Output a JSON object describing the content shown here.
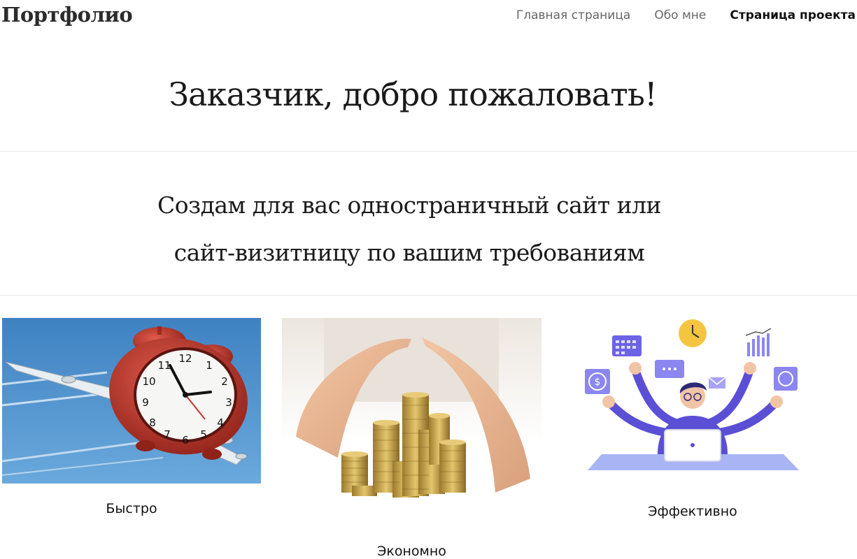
{
  "header": {
    "brand": "Портфолио",
    "nav": [
      {
        "label": "Главная страница",
        "active": false
      },
      {
        "label": "Обо мне",
        "active": false
      },
      {
        "label": "Страница проекта",
        "active": true
      }
    ]
  },
  "hero": {
    "title": "Заказчик, добро пожаловать!"
  },
  "intro": {
    "line1": "Создам для вас одностраничный сайт или",
    "line2": "сайт-визитницу по вашим требованиям"
  },
  "features": [
    {
      "label": "Быстро",
      "image": "alarm-clock-with-wings-image"
    },
    {
      "label": "Экономно",
      "image": "hands-over-coin-stacks-image"
    },
    {
      "label": "Эффективно",
      "image": "multitasking-person-illustration"
    }
  ],
  "colors": {
    "sky": "#4b8fc9",
    "clock_red": "#c4352b",
    "coin_gold": "#c9a54a",
    "illustration_purple": "#5b4fd6"
  }
}
